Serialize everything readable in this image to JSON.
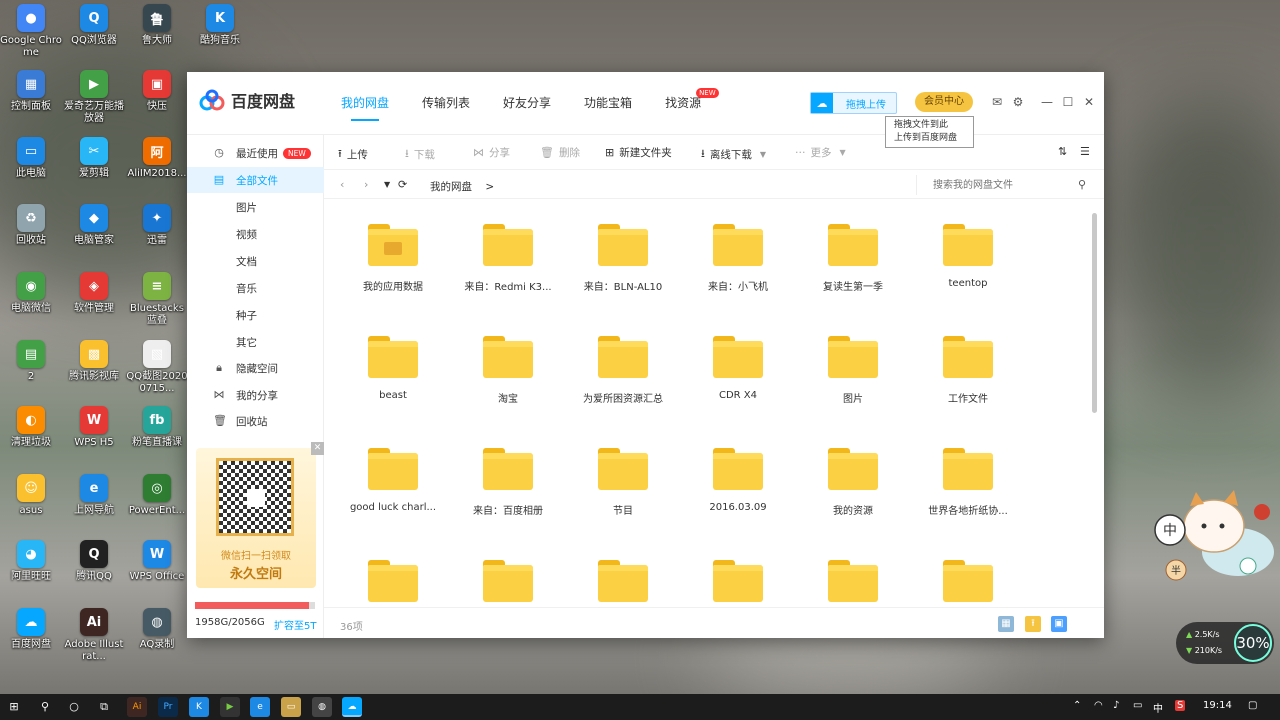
{
  "desktop": {
    "icons": [
      {
        "label": "Google Chrome",
        "glyph": "●",
        "color": "#4285f4"
      },
      {
        "label": "QQ浏览器",
        "glyph": "Q",
        "color": "#1e88e5"
      },
      {
        "label": "鲁大师",
        "glyph": "鲁",
        "color": "#37474f"
      },
      {
        "label": "酷狗音乐",
        "glyph": "K",
        "color": "#1e88e5"
      },
      {
        "label": "控制面板",
        "glyph": "▦",
        "color": "#3a7bd5"
      },
      {
        "label": "爱奇艺万能播放器",
        "glyph": "▶",
        "color": "#43a047"
      },
      {
        "label": "快压",
        "glyph": "▣",
        "color": "#e53935"
      },
      {
        "label": "此电脑",
        "glyph": "▭",
        "color": "#1e88e5"
      },
      {
        "label": "爱剪辑",
        "glyph": "✂",
        "color": "#29b6f6"
      },
      {
        "label": "AliIM2018...",
        "glyph": "阿",
        "color": "#ef6c00"
      },
      {
        "label": "回收站",
        "glyph": "♻",
        "color": "#90a4ae"
      },
      {
        "label": "电脑管家",
        "glyph": "◆",
        "color": "#1e88e5"
      },
      {
        "label": "迅雷",
        "glyph": "✦",
        "color": "#1976d2"
      },
      {
        "label": "电脑微信",
        "glyph": "◉",
        "color": "#43a047"
      },
      {
        "label": "软件管理",
        "glyph": "◈",
        "color": "#e53935"
      },
      {
        "label": "Bluestacks蓝叠",
        "glyph": "≡",
        "color": "#7cb342"
      },
      {
        "label": "2",
        "glyph": "▤",
        "color": "#43a047"
      },
      {
        "label": "腾讯影视库",
        "glyph": "▩",
        "color": "#fbc02d"
      },
      {
        "label": "QQ截图20200715...",
        "glyph": "▧",
        "color": "#eeeeee"
      },
      {
        "label": "清理垃圾",
        "glyph": "◐",
        "color": "#fb8c00"
      },
      {
        "label": "WPS H5",
        "glyph": "W",
        "color": "#e53935"
      },
      {
        "label": "粉笔直播课",
        "glyph": "fb",
        "color": "#26a69a"
      },
      {
        "label": "asus",
        "glyph": "☺",
        "color": "#fbc02d"
      },
      {
        "label": "上网导航",
        "glyph": "e",
        "color": "#1e88e5"
      },
      {
        "label": "PowerEnt...",
        "glyph": "◎",
        "color": "#2e7d32"
      },
      {
        "label": "阿里旺旺",
        "glyph": "◕",
        "color": "#29b6f6"
      },
      {
        "label": "腾讯QQ",
        "glyph": "Q",
        "color": "#212121"
      },
      {
        "label": "WPS Office",
        "glyph": "W",
        "color": "#1e88e5"
      },
      {
        "label": "百度网盘",
        "glyph": "☁",
        "color": "#06a7ff"
      },
      {
        "label": "Adobe Illustrat...",
        "glyph": "Ai",
        "color": "#3e2723"
      },
      {
        "label": "AQ录制",
        "glyph": "◍",
        "color": "#455a64"
      }
    ]
  },
  "app": {
    "name": "百度网盘",
    "accent": "#06a7ff",
    "tabs": [
      {
        "label": "我的网盘",
        "active": true
      },
      {
        "label": "传输列表",
        "active": false
      },
      {
        "label": "好友分享",
        "active": false
      },
      {
        "label": "功能宝箱",
        "active": false
      },
      {
        "label": "找资源",
        "active": false,
        "badge": "NEW"
      }
    ],
    "drag_upload_label": "拖拽上传",
    "vip_label": "会员中心",
    "tooltip": {
      "line1": "拖拽文件到此",
      "line2": "上传到百度网盘"
    },
    "window_icons": [
      "mail-icon",
      "gear-icon",
      "minimize-icon",
      "maximize-icon",
      "close-icon"
    ]
  },
  "sidebar": {
    "items": [
      {
        "label": "最近使用",
        "icon": "clock-icon",
        "badge": "NEW"
      },
      {
        "label": "全部文件",
        "icon": "file-icon",
        "active": true
      },
      {
        "label": "图片"
      },
      {
        "label": "视频"
      },
      {
        "label": "文档"
      },
      {
        "label": "音乐"
      },
      {
        "label": "种子"
      },
      {
        "label": "其它"
      },
      {
        "label": "隐藏空间",
        "icon": "lock-icon"
      },
      {
        "label": "我的分享",
        "icon": "share-icon"
      },
      {
        "label": "回收站",
        "icon": "trash-icon"
      }
    ],
    "promo": {
      "line1": "微信扫一扫领取",
      "line2": "永久空间"
    },
    "quota": {
      "text": "1958G/2056G",
      "used_fraction": 0.952,
      "expand_label": "扩容至5T"
    }
  },
  "toolbar": {
    "upload": "上传",
    "download": "下载",
    "share": "分享",
    "delete": "删除",
    "new_folder": "新建文件夹",
    "offline_download": "离线下载",
    "more": "更多"
  },
  "address": {
    "crumb": "我的网盘",
    "crumb_sep": ">",
    "search_placeholder": "搜索我的网盘文件"
  },
  "files": [
    {
      "name": "我的应用数据",
      "app_data": true
    },
    {
      "name": "来自：Redmi K3..."
    },
    {
      "name": "来自：BLN-AL10"
    },
    {
      "name": "来自：小飞机"
    },
    {
      "name": "复读生第一季"
    },
    {
      "name": "teentop"
    },
    {
      "name": "beast"
    },
    {
      "name": "淘宝"
    },
    {
      "name": "为爱所困资源汇总"
    },
    {
      "name": "CDR X4"
    },
    {
      "name": "图片"
    },
    {
      "name": "工作文件"
    },
    {
      "name": "good luck charl..."
    },
    {
      "name": "来自：百度相册"
    },
    {
      "name": "节目"
    },
    {
      "name": "2016.03.09"
    },
    {
      "name": "我的资源"
    },
    {
      "name": "世界各地折纸协..."
    },
    {
      "name": ""
    },
    {
      "name": ""
    },
    {
      "name": ""
    },
    {
      "name": ""
    },
    {
      "name": ""
    },
    {
      "name": ""
    }
  ],
  "status": {
    "count": "36项"
  },
  "widget": {
    "up": "2.5K/s",
    "down": "210K/s",
    "percent": "30%"
  },
  "taskbar": {
    "time": "19:14",
    "ime": "中"
  }
}
